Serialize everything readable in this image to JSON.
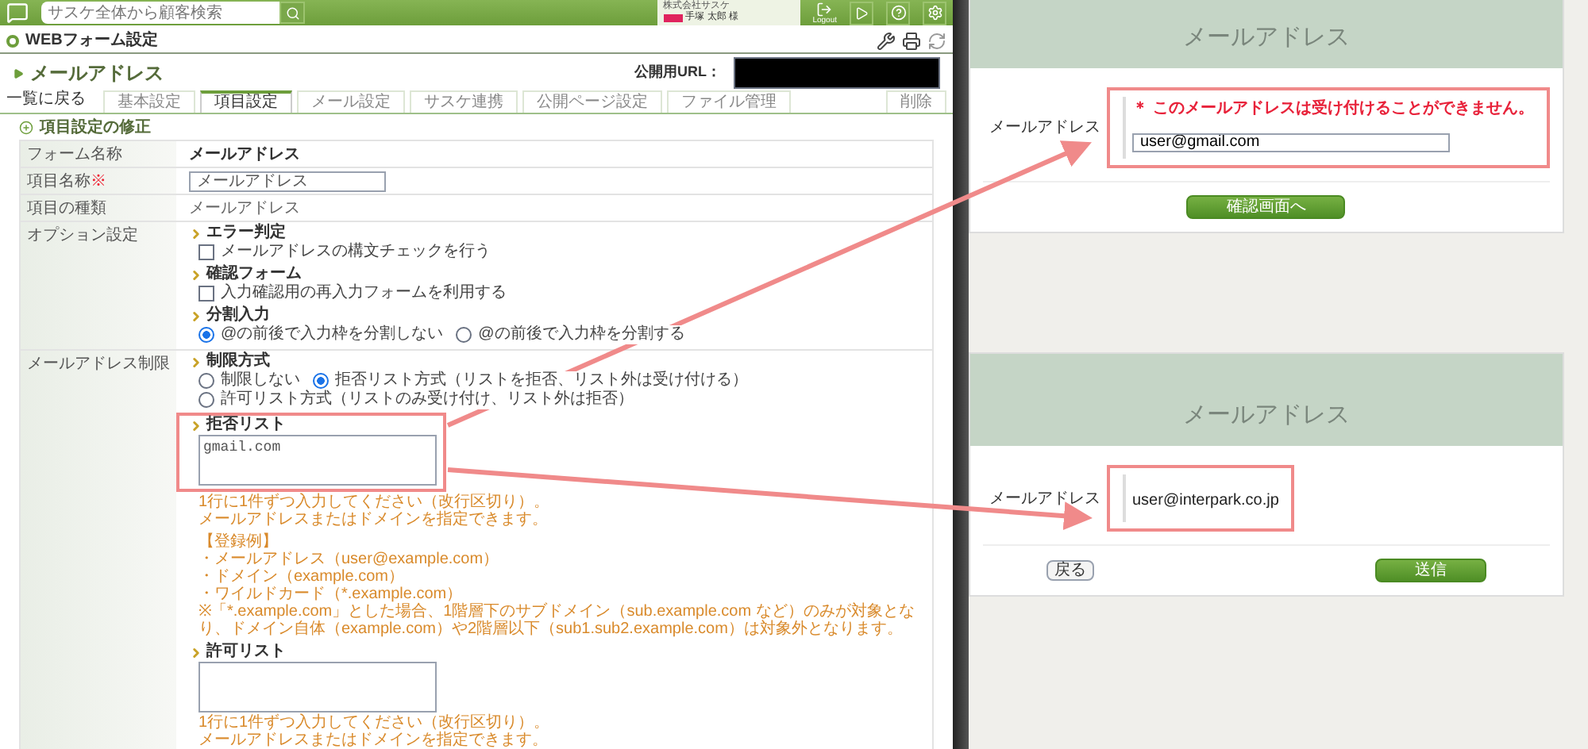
{
  "top_bar": {
    "search": {
      "placeholder": "サスケ全体から顧客検索"
    },
    "user": {
      "company": "株式会社サスケ",
      "name": "手塚 太郎 様"
    },
    "logout": "Logout"
  },
  "page_header": {
    "title": "WEBフォーム設定"
  },
  "form_title": "メールアドレス",
  "public_url_label": "公開用URL：",
  "back_link": "一覧に戻る",
  "tabs": [
    {
      "label": "基本設定",
      "selected": false
    },
    {
      "label": "項目設定",
      "selected": true
    },
    {
      "label": "メール設定",
      "selected": false
    },
    {
      "label": "サスケ連携",
      "selected": false
    },
    {
      "label": "公開ページ設定",
      "selected": false
    },
    {
      "label": "ファイル管理",
      "selected": false
    }
  ],
  "delete_button": "削除",
  "section_title": "項目設定の修正",
  "rows": [
    {
      "label": "フォーム名称",
      "kind": "bold",
      "value": "メールアドレス"
    },
    {
      "label": "項目名称",
      "required_mark": "※",
      "kind": "input",
      "value": "メールアドレス"
    },
    {
      "label": "項目の種類",
      "kind": "plain",
      "value": "メールアドレス"
    },
    {
      "label": "オプション設定",
      "kind": "groups",
      "groups": [
        {
          "title": "エラー判定",
          "kind": "checkbox",
          "options": [
            {
              "label": "メールアドレスの構文チェックを行う",
              "checked": false
            }
          ]
        },
        {
          "title": "確認フォーム",
          "kind": "checkbox",
          "options": [
            {
              "label": "入力確認用の再入力フォームを利用する",
              "checked": false
            }
          ]
        },
        {
          "title": "分割入力",
          "kind": "radio",
          "options": [
            {
              "label": "@の前後で入力枠を分割しない",
              "selected": true
            },
            {
              "label": "@の前後で入力枠を分割する",
              "selected": false
            }
          ]
        }
      ]
    },
    {
      "label": "メールアドレス制限",
      "kind": "groups",
      "groups": [
        {
          "title": "制限方式",
          "kind": "radio",
          "options": [
            {
              "label": "制限しない",
              "selected": false
            },
            {
              "label": "拒否リスト方式（リストを拒否、リスト外は受け付ける）",
              "selected": true
            },
            {
              "label": "許可リスト方式（リストのみ受け付け、リスト外は拒否）",
              "selected": false
            }
          ]
        },
        {
          "title": "拒否リスト",
          "kind": "list",
          "highlighted": true,
          "value": "gmail.com",
          "notes": [
            "1行に1件ずつ入力してください（改行区切り）。",
            "メールアドレスまたはドメインを指定できます。"
          ],
          "example": {
            "heading": "【登録例】",
            "lines": [
              "・メールアドレス（user@example.com）",
              "・ドメイン（example.com）",
              "・ワイルドカード（*.example.com）",
              "※「*.example.com」とした場合、1階層下のサブドメイン（sub.example.com など）のみが対象となり、ドメイン自体（example.com）や2階層以下（sub1.sub2.example.com）は対象外となります。"
            ]
          }
        },
        {
          "title": "許可リスト",
          "kind": "list",
          "highlighted": false,
          "notes": [
            "1行に1件ずつ入力してください（改行区切り）。",
            "メールアドレスまたはドメインを指定できます。"
          ]
        }
      ]
    }
  ],
  "previews": [
    {
      "header": "メールアドレス",
      "label": "メールアドレス",
      "kind": "error",
      "highlighted": true,
      "error": "＊ このメールアドレスは受け付けることができません。",
      "value": "user@gmail.com",
      "buttons": [
        {
          "label": "確認画面へ",
          "kind": "primary"
        }
      ]
    },
    {
      "header": "メールアドレス",
      "label": "メールアドレス",
      "kind": "confirm",
      "highlighted": true,
      "value": "user@interpark.co.jp",
      "buttons": [
        {
          "label": "戻る",
          "kind": "secondary"
        },
        {
          "label": "送信",
          "kind": "primary"
        }
      ]
    }
  ]
}
